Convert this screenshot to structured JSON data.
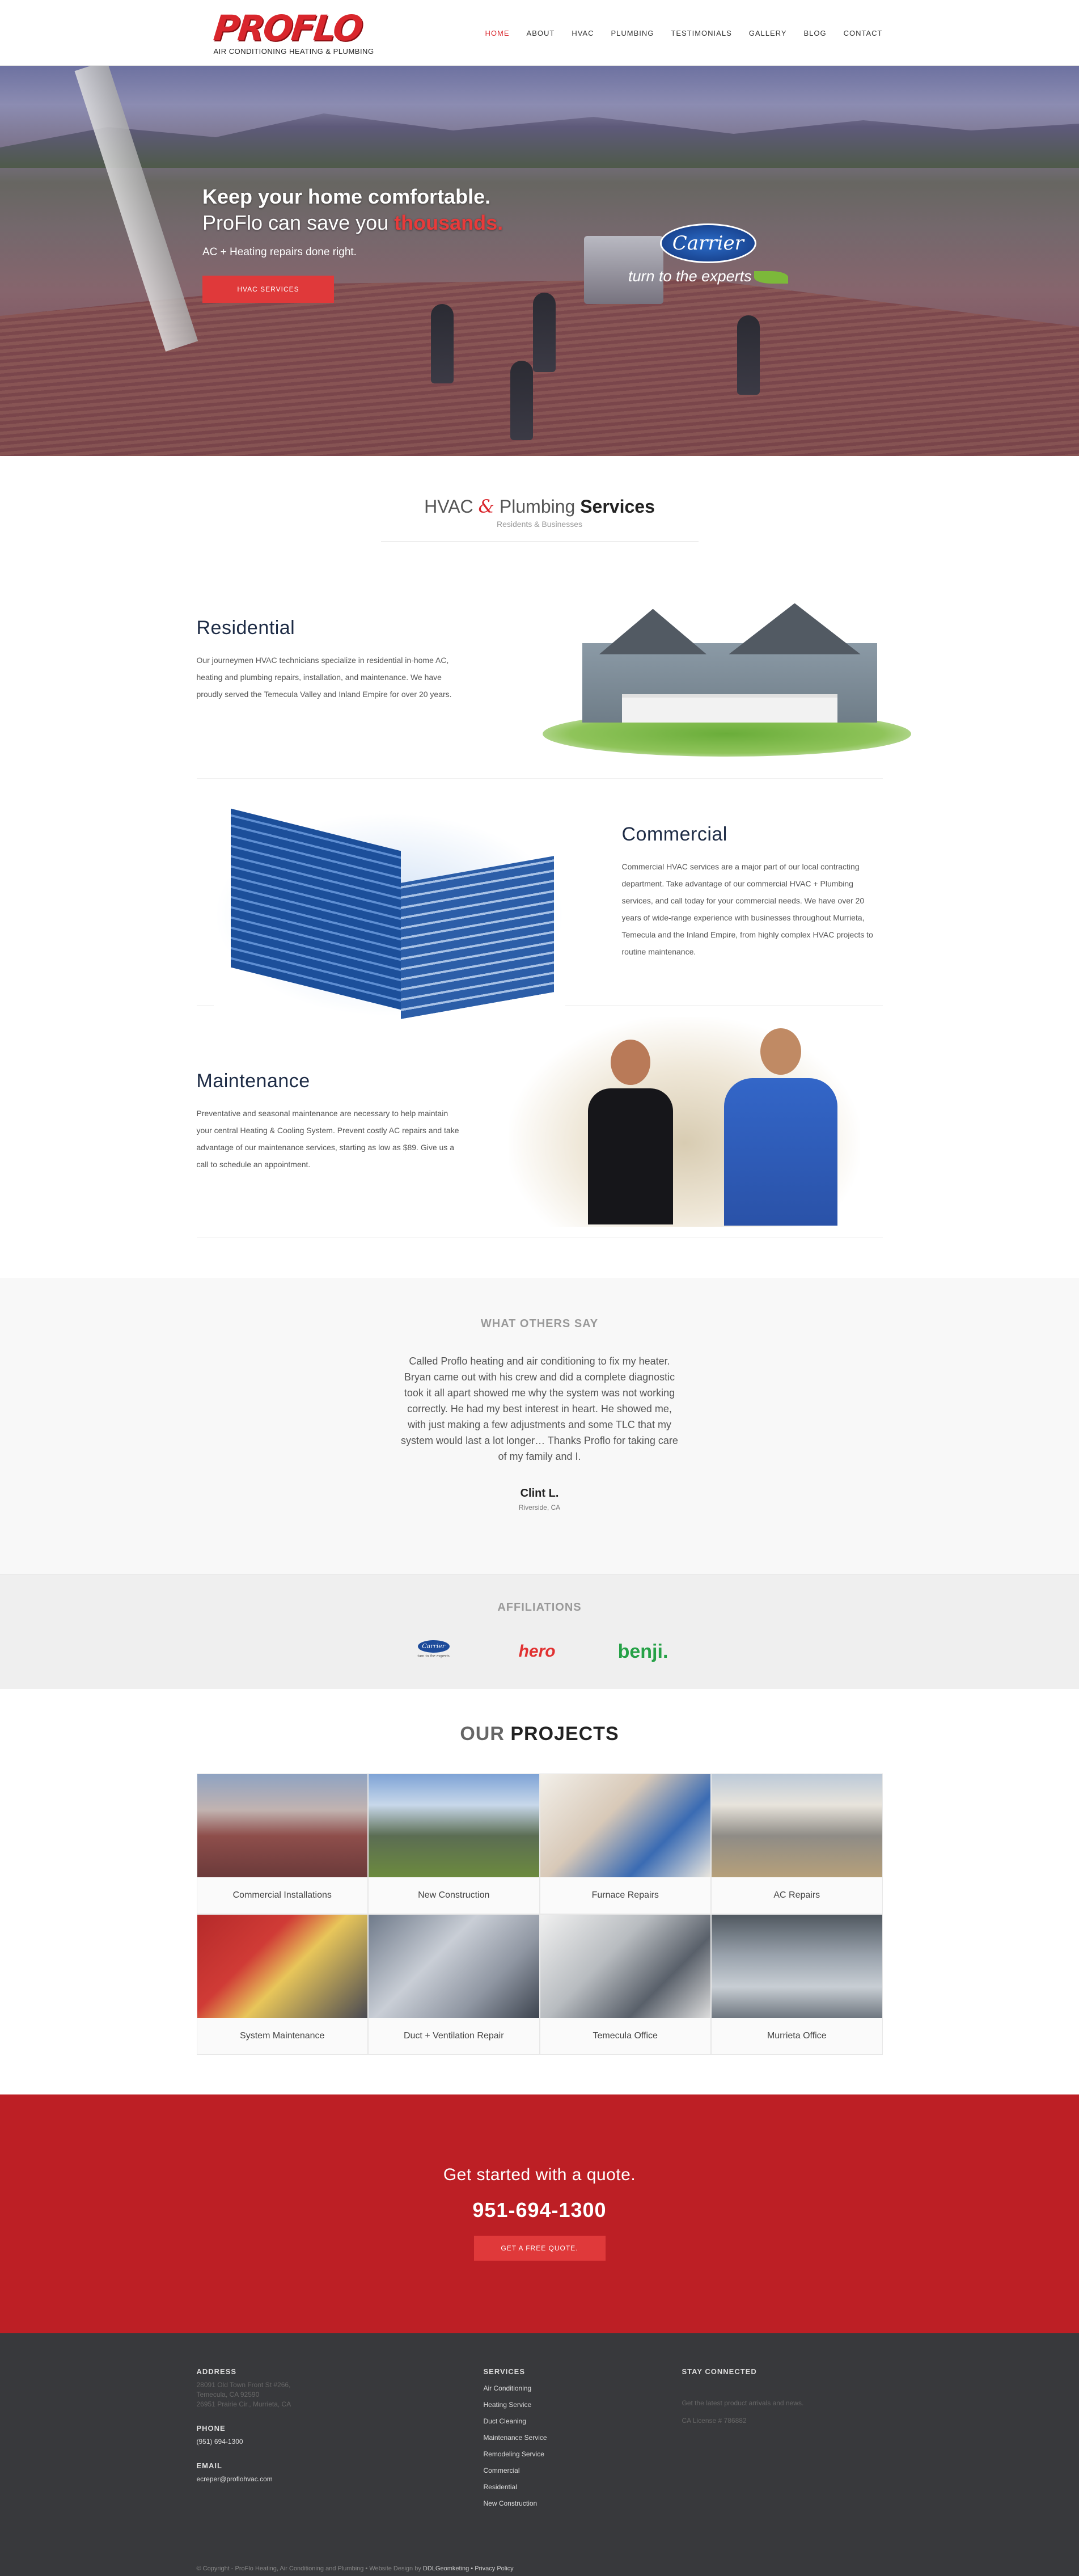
{
  "header": {
    "logo_word": "PROFLO",
    "logo_sub": "AIR CONDITIONING HEATING & PLUMBING",
    "nav": [
      "HOME",
      "ABOUT",
      "HVAC",
      "PLUMBING",
      "TESTIMONIALS",
      "GALLERY",
      "BLOG",
      "CONTACT"
    ],
    "active_nav": "HOME"
  },
  "hero": {
    "headline": "Keep your home comfortable.",
    "subhead_prefix": "ProFlo can save you ",
    "subhead_highlight": "thousands.",
    "tagline": "AC + Heating repairs done right.",
    "button": "HVAC SERVICES",
    "partner_logo": "Carrier",
    "partner_tagline": "turn to the experts"
  },
  "services": {
    "title_prefix": "HVAC ",
    "title_amp": "&",
    "title_middle": " Plumbing ",
    "title_bold": "Services",
    "subtitle": "Residents & Businesses",
    "items": [
      {
        "title": "Residential",
        "desc": "Our journeymen HVAC technicians specialize in residential in-home AC, heating and plumbing repairs, installation, and maintenance. We have proudly served the Temecula Valley and Inland Empire for over 20 years."
      },
      {
        "title": "Commercial",
        "desc": "Commercial HVAC services are a major part of our local contracting department. Take advantage of our commercial HVAC + Plumbing services, and call today for your commercial needs. We have over 20 years of wide-range experience with businesses throughout Murrieta, Temecula and the Inland Empire, from highly complex HVAC projects to routine maintenance."
      },
      {
        "title": "Maintenance",
        "desc": "Preventative and seasonal maintenance are necessary to help maintain your central Heating & Cooling System. Prevent costly AC repairs and take advantage of our maintenance services, starting as low as $89. Give us a call to schedule an appointment."
      }
    ]
  },
  "testimonial": {
    "label": "WHAT OTHERS SAY",
    "quote": "Called Proflo heating and air conditioning to fix my heater. Bryan came out with his crew and did a complete diagnostic took it all apart showed me why the system was not working correctly. He had my best interest in heart. He showed me, with just making a few adjustments and some TLC that my system would last a lot longer… Thanks Proflo for taking care of my family and I.",
    "author": "Clint L.",
    "location": "Riverside, CA"
  },
  "affiliations": {
    "label": "AFFILIATIONS",
    "carrier": "Carrier",
    "carrier_tag": "turn to the experts",
    "hero": "hero",
    "benji": "benji."
  },
  "projects": {
    "title_prefix": "OUR ",
    "title_bold": "PROJECTS",
    "items": [
      "Commercial Installations",
      "New Construction",
      "Furnace Repairs",
      "AC Repairs",
      "System Maintenance",
      "Duct + Ventilation Repair",
      "Temecula Office",
      "Murrieta Office"
    ]
  },
  "cta": {
    "line": "Get started with a quote.",
    "phone": "951-694-1300",
    "button": "GET A FREE QUOTE."
  },
  "footer": {
    "address_label": "ADDRESS",
    "address_lines": [
      "28091 Old Town Front St #266,",
      "Temecula, CA 92590",
      "26951 Prairie Cir., Murrieta, CA"
    ],
    "phone_label": "PHONE",
    "phone": "(951) 694-1300",
    "email_label": "EMAIL",
    "email": "ecreper@proflohvac.com",
    "services_label": "SERVICES",
    "services": [
      "Air Conditioning",
      "Heating Service",
      "Duct Cleaning",
      "Maintenance Service",
      "Remodeling Service",
      "Commercial",
      "Residential",
      "New Construction"
    ],
    "stay_label": "STAY CONNECTED",
    "stay_text": "Get the latest product arrivals and news.",
    "license": "CA License # 786882",
    "copyright_prefix": "© Copyright - ProFlo Heating, Air Conditioning and Plumbing • Website Design by ",
    "copyright_designer": "DDLGeomketing",
    "copyright_suffix": " • Privacy Policy"
  },
  "colors": {
    "brand_red": "#d9262c",
    "cta_red": "#bd1f25",
    "button_red": "#e0393a",
    "heading_navy": "#1d2b45",
    "footer_bg": "#38393c"
  }
}
